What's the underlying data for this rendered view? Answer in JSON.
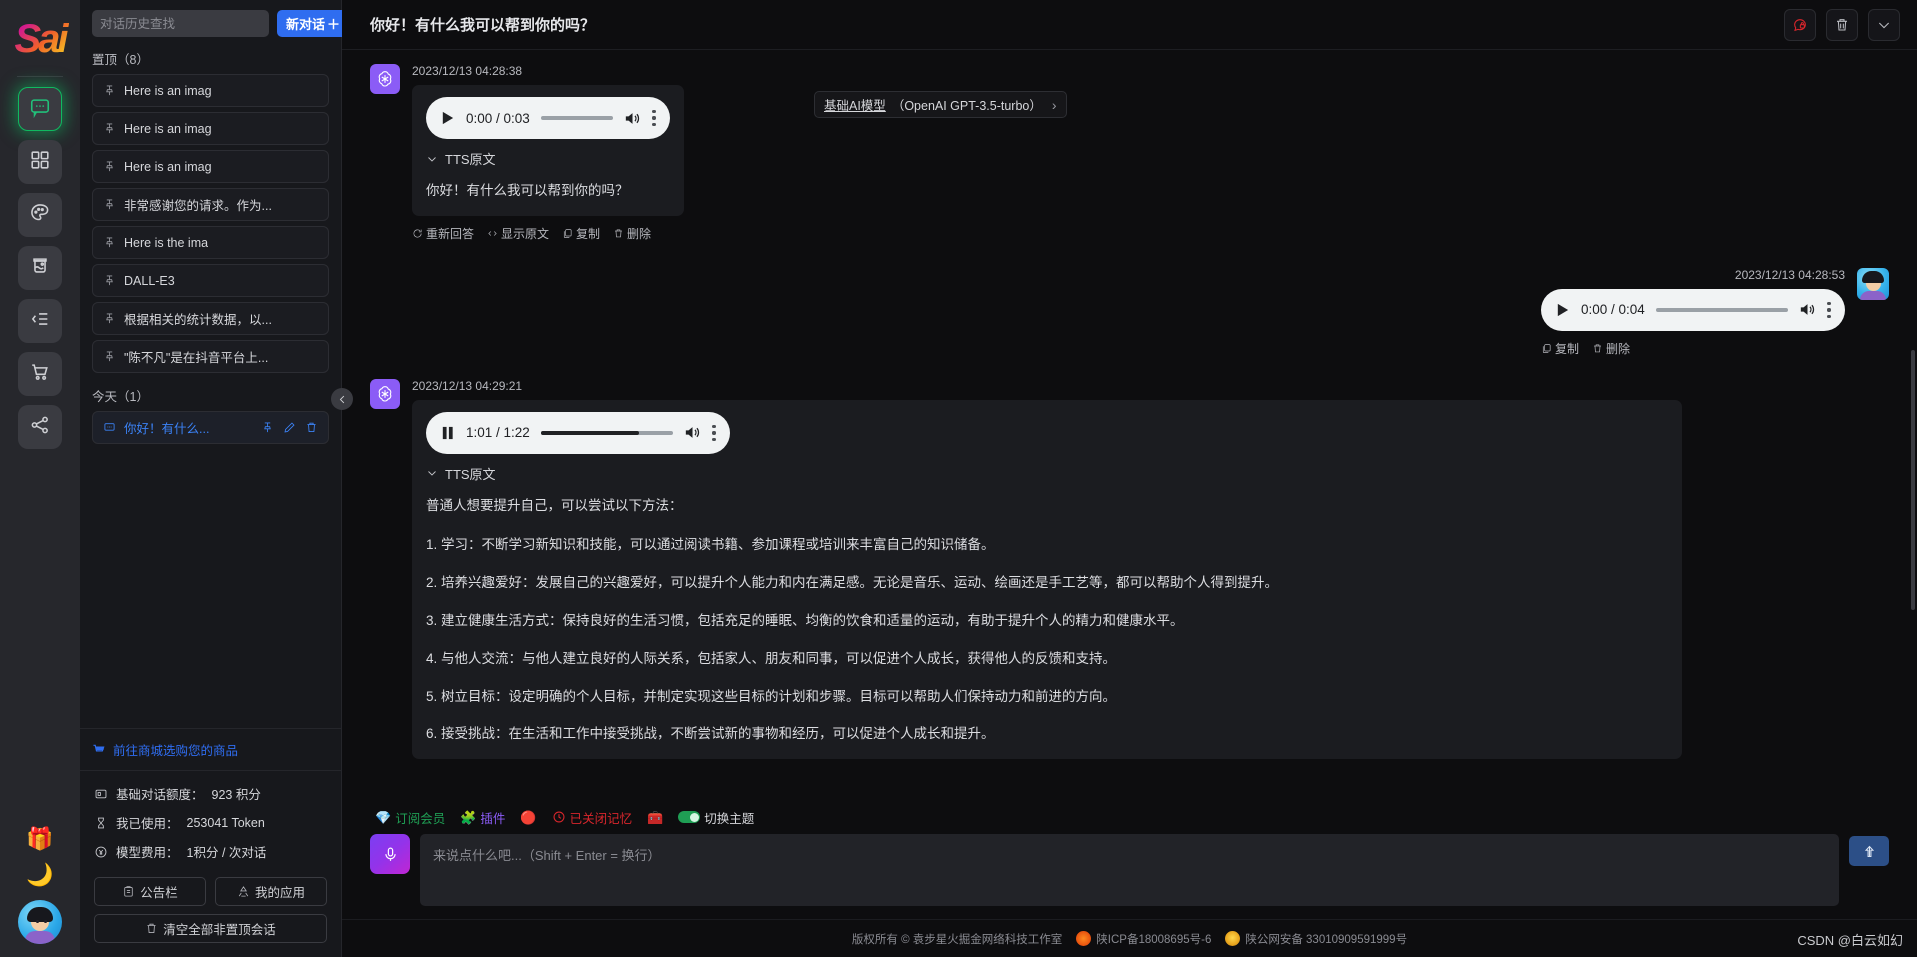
{
  "brand": {
    "logo_text": "Sai"
  },
  "rail": {
    "items": [
      {
        "name": "chat",
        "icon": "chat-bubble-icon",
        "active": true
      },
      {
        "name": "apps",
        "icon": "grid-apps-icon",
        "active": false
      },
      {
        "name": "drawing",
        "icon": "palette-icon",
        "active": false
      },
      {
        "name": "gallery",
        "icon": "aquarium-icon",
        "active": false
      },
      {
        "name": "list",
        "icon": "list-indent-icon",
        "active": false
      },
      {
        "name": "shop",
        "icon": "shopping-cart-icon",
        "active": false
      },
      {
        "name": "share",
        "icon": "share-nodes-icon",
        "active": false
      }
    ],
    "gift_emoji": "🎁",
    "moon_emoji": "🌙"
  },
  "sidebar": {
    "search": {
      "placeholder": "对话历史查找",
      "value": ""
    },
    "new_chat_label": "新对话",
    "new_chat_plus": "＋",
    "pinned_group": "置顶（8）",
    "today_group": "今天（1）",
    "pinned_items": [
      {
        "title": "Here is an imag"
      },
      {
        "title": "Here is an imag"
      },
      {
        "title": "Here is an imag"
      },
      {
        "title": "非常感谢您的请求。作为..."
      },
      {
        "title": "Here is the ima"
      },
      {
        "title": "DALL-E3"
      },
      {
        "title": "根据相关的统计数据，以..."
      },
      {
        "title": "\"陈不凡\"是在抖音平台上..."
      }
    ],
    "today_items": [
      {
        "title": "你好！有什么...",
        "selected": true
      }
    ],
    "shop_link": "前往商城选购您的商品",
    "meta": [
      {
        "icon": "credit-card-icon",
        "label": "基础对话额度：",
        "value": "923 积分"
      },
      {
        "icon": "hourglass-icon",
        "label": "我已使用：",
        "value": "253041 Token"
      },
      {
        "icon": "coin-icon",
        "label": "模型费用：",
        "value": "1积分 / 次对话"
      }
    ],
    "buttons": {
      "announcements": "公告栏",
      "my_apps": "我的应用",
      "clear_all": "清空全部非置顶会话"
    }
  },
  "header": {
    "title": "你好！有什么我可以帮到你的吗？",
    "actions": [
      {
        "name": "lock-chat",
        "icon": "locked-chat-icon"
      },
      {
        "name": "delete-chat",
        "icon": "trash-icon"
      },
      {
        "name": "more",
        "icon": "chevron-down-icon"
      }
    ]
  },
  "model_badge": {
    "name": "基础AI模型",
    "detail": "（OpenAI GPT-3.5-turbo）",
    "chevron": "›"
  },
  "messages": [
    {
      "role": "assistant",
      "timestamp": "2023/12/13 04:28:38",
      "audio": {
        "state": "paused",
        "current": "0:00",
        "duration": "0:03",
        "progress": 0
      },
      "tts_label": "TTS原文",
      "text": [
        "你好！有什么我可以帮到你的吗？"
      ],
      "actions": [
        {
          "label": "重新回答",
          "icon": "refresh-icon"
        },
        {
          "label": "显示原文",
          "icon": "code-icon"
        },
        {
          "label": "复制",
          "icon": "copy-icon"
        },
        {
          "label": "删除",
          "icon": "trash-icon"
        }
      ]
    },
    {
      "role": "user",
      "timestamp": "2023/12/13 04:28:53",
      "audio": {
        "state": "paused",
        "current": "0:00",
        "duration": "0:04",
        "progress": 0
      },
      "actions": [
        {
          "label": "复制",
          "icon": "copy-icon"
        },
        {
          "label": "删除",
          "icon": "trash-icon"
        }
      ]
    },
    {
      "role": "assistant",
      "timestamp": "2023/12/13 04:29:21",
      "audio": {
        "state": "playing",
        "current": "1:01",
        "duration": "1:22",
        "progress": 74
      },
      "tts_label": "TTS原文",
      "text": [
        "普通人想要提升自己，可以尝试以下方法：",
        "1. 学习：不断学习新知识和技能，可以通过阅读书籍、参加课程或培训来丰富自己的知识储备。",
        "2. 培养兴趣爱好：发展自己的兴趣爱好，可以提升个人能力和内在满足感。无论是音乐、运动、绘画还是手工艺等，都可以帮助个人得到提升。",
        "3. 建立健康生活方式：保持良好的生活习惯，包括充足的睡眠、均衡的饮食和适量的运动，有助于提升个人的精力和健康水平。",
        "4. 与他人交流：与他人建立良好的人际关系，包括家人、朋友和同事，可以促进个人成长，获得他人的反馈和支持。",
        "5. 树立目标：设定明确的个人目标，并制定实现这些目标的计划和步骤。目标可以帮助人们保持动力和前进的方向。",
        "6. 接受挑战：在生活和工作中接受挑战，不断尝试新的事物和经历，可以促进个人成长和提升。"
      ]
    }
  ],
  "toolbar": [
    {
      "icon": "diamond-icon",
      "glyph": "💎",
      "label": "订阅会员",
      "color": "#1f9e54"
    },
    {
      "icon": "puzzle-icon",
      "glyph": "🧩",
      "label": "插件",
      "color": "#8b5cf6"
    },
    {
      "icon": "ball-icon",
      "glyph": "🔴",
      "label": "",
      "color": "#d9262c"
    },
    {
      "icon": "clock-icon",
      "glyph": "🕐",
      "label": "已关闭记忆",
      "color": "#d9262c"
    },
    {
      "icon": "toolbox-icon",
      "glyph": "🧰",
      "label": "",
      "color": "#2f6df0"
    },
    {
      "icon": "toggle-icon",
      "glyph": "",
      "label": "切换主题",
      "color": "#d6d7db"
    }
  ],
  "composer": {
    "mic_icon": "microphone-icon",
    "placeholder": "来说点什么吧...（Shift + Enter = 换行）",
    "value": "",
    "send_icon": "arrow-up-icon"
  },
  "footer": {
    "copyright": "版权所有 © 袁步星火掘金网络科技工作室",
    "icp": "陕ICP备18008695号-6",
    "gov": "陕公网安备 33010909591999号"
  },
  "watermark": "CSDN @白云如幻"
}
